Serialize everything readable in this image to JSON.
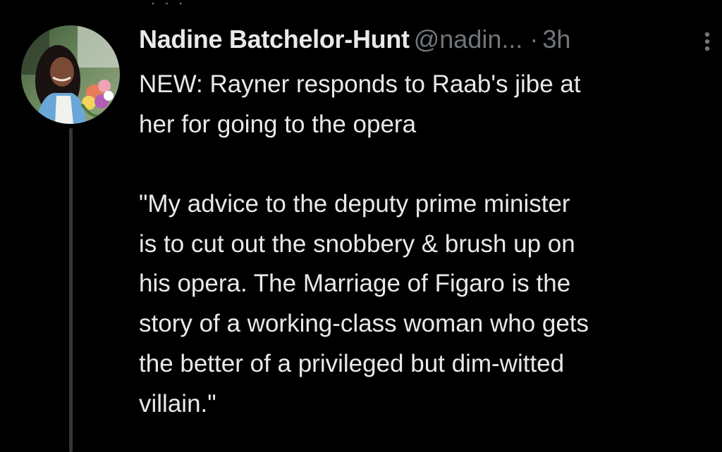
{
  "tweet": {
    "display_name": "Nadine Batchelor-Hunt",
    "handle": "@nadin...",
    "separator": "·",
    "time": "3h",
    "more_icon": "more-vertical-icon",
    "text_lines": [
      "NEW: Rayner responds to Raab's jibe at",
      "her for going to the opera",
      "",
      "\"My advice to the deputy prime minister",
      "is to cut out the snobbery & brush up on",
      "his opera. The Marriage of Figaro is the",
      "story of a working-class woman who gets",
      "the better of a privileged but dim-witted",
      "villain.\""
    ]
  },
  "colors": {
    "background": "#000000",
    "primary_text": "#e7e9ea",
    "secondary_text": "#71767b",
    "thread_line": "#333639"
  }
}
